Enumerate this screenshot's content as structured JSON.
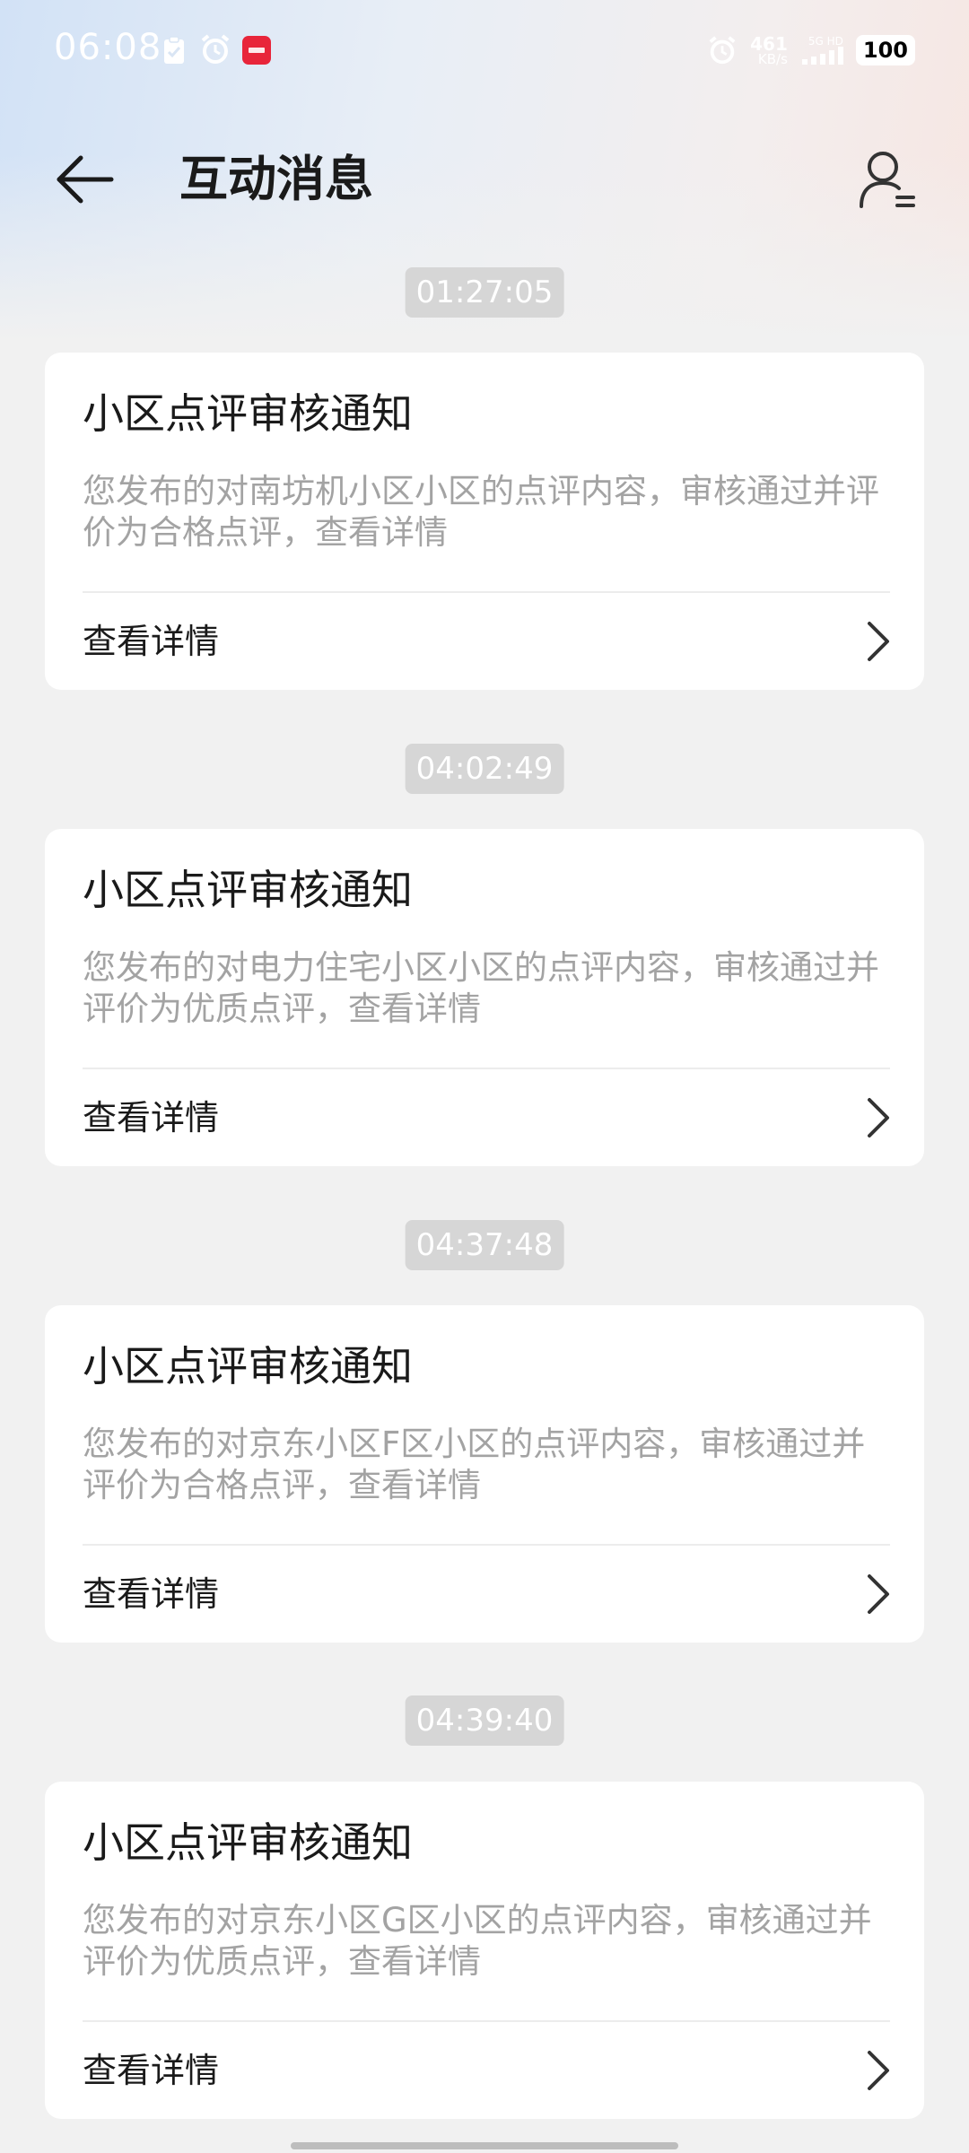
{
  "status_bar": {
    "time": "06:08",
    "net_speed_value": "461",
    "net_speed_unit": "KB/s",
    "signal_label": "5G HD",
    "battery": "100",
    "icons": [
      "clipboard-check-icon",
      "alarm-icon",
      "app-badge-icon",
      "alarm-icon",
      "signal-bars-icon"
    ]
  },
  "header": {
    "title": "互动消息",
    "back_icon": "arrow-left-icon",
    "profile_icon": "user-settings-icon"
  },
  "messages": [
    {
      "time": "01:27:05",
      "title": "小区点评审核通知",
      "body": "您发布的对南坊机小区小区的点评内容，审核通过并评价为合格点评，查看详情",
      "link": "查看详情"
    },
    {
      "time": "04:02:49",
      "title": "小区点评审核通知",
      "body": "您发布的对电力住宅小区小区的点评内容，审核通过并评价为优质点评，查看详情",
      "link": "查看详情"
    },
    {
      "time": "04:37:48",
      "title": "小区点评审核通知",
      "body": "您发布的对京东小区F区小区的点评内容，审核通过并评价为合格点评，查看详情",
      "link": "查看详情"
    },
    {
      "time": "04:39:40",
      "title": "小区点评审核通知",
      "body": "您发布的对京东小区G区小区的点评内容，审核通过并评价为优质点评，查看详情",
      "link": "查看详情"
    }
  ],
  "colors": {
    "accent_badge": "#e8253a",
    "chip_bg": "#d6d6d6",
    "card_bg": "#ffffff",
    "page_bg": "#f1f1f1"
  }
}
